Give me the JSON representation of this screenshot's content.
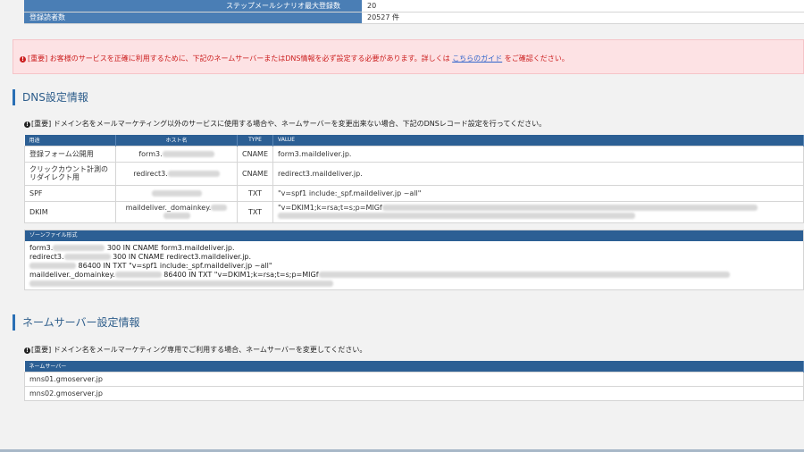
{
  "top_table": {
    "rows": [
      {
        "label": "ステップメールシナリオ最大登録数",
        "value": "20"
      },
      {
        "label": "登録読者数",
        "value": "20527 件"
      }
    ]
  },
  "alert": {
    "prefix": "[重要] お客様のサービスを正確に利用するために、下記のネームサーバーまたはDNS情報を必ず設定する必要があります。詳しくは ",
    "link": "こちらのガイド",
    "suffix": " をご確認ください。"
  },
  "dns": {
    "title": "DNS設定情報",
    "note": "[重要] ドメイン名をメールマーケティング以外のサービスに使用する場合や、ネームサーバーを変更出来ない場合、下記のDNSレコード設定を行ってください。",
    "headers": {
      "purpose": "用途",
      "host": "ホスト名",
      "type": "TYPE",
      "value": "VALUE"
    },
    "rows": [
      {
        "purpose": "登録フォーム公開用",
        "host": "form3.",
        "type": "CNAME",
        "value": "form3.maildeliver.jp."
      },
      {
        "purpose": "クリックカウント計測の\nリダイレクト用",
        "host": "redirect3.",
        "type": "CNAME",
        "value": "redirect3.maildeliver.jp."
      },
      {
        "purpose": "SPF",
        "host": "",
        "type": "TXT",
        "value": "\"v=spf1 include:_spf.maildeliver.jp ~all\""
      },
      {
        "purpose": "DKIM",
        "host": "maildeliver._domainkey.",
        "type": "TXT",
        "value": "\"v=DKIM1;k=rsa;t=s;p=MIGf"
      }
    ]
  },
  "zone": {
    "header": "ゾーンファイル形式",
    "lines": [
      {
        "pre": "form3.",
        "post": " 300 IN CNAME form3.maildeliver.jp."
      },
      {
        "pre": "redirect3.",
        "post": " 300 IN CNAME redirect3.maildeliver.jp."
      },
      {
        "pre": "",
        "post": " 86400 IN TXT \"v=spf1 include:_spf.maildeliver.jp ~all\""
      },
      {
        "pre": "maildeliver._domainkey.",
        "post": " 86400 IN TXT \"v=DKIM1;k=rsa;t=s;p=MIGf"
      }
    ]
  },
  "ns": {
    "title": "ネームサーバー設定情報",
    "note": "[重要] ドメイン名をメールマーケティング専用でご利用する場合、ネームサーバーを変更してください。",
    "header": "ネームサーバー",
    "servers": [
      "mns01.gmoserver.jp",
      "mns02.gmoserver.jp"
    ]
  },
  "colors": {
    "accent": "#2c5f94",
    "alert_bg": "#fde2e4",
    "alert_text": "#cc1f1f"
  }
}
